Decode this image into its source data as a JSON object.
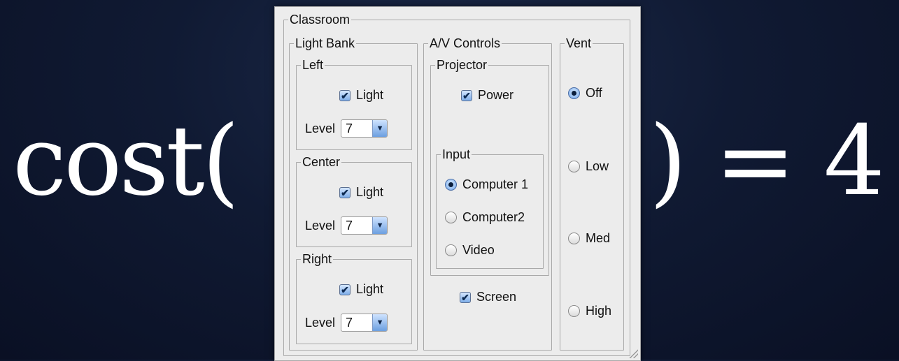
{
  "slide": {
    "cost_text": "cost(",
    "rhs_text": ") = 4"
  },
  "panel": {
    "title": "Classroom",
    "light_bank": {
      "title": "Light Bank",
      "groups": [
        {
          "title": "Left",
          "light_label": "Light",
          "light_checked": true,
          "level_label": "Level",
          "level_value": "7"
        },
        {
          "title": "Center",
          "light_label": "Light",
          "light_checked": true,
          "level_label": "Level",
          "level_value": "7"
        },
        {
          "title": "Right",
          "light_label": "Light",
          "light_checked": true,
          "level_label": "Level",
          "level_value": "7"
        }
      ]
    },
    "av": {
      "title": "A/V Controls",
      "projector": {
        "title": "Projector",
        "power_label": "Power",
        "power_checked": true,
        "input": {
          "title": "Input",
          "options": [
            "Computer 1",
            "Computer2",
            "Video"
          ],
          "selected": "Computer 1"
        }
      },
      "screen_label": "Screen",
      "screen_checked": true
    },
    "vent": {
      "title": "Vent",
      "options": [
        "Off",
        "Low",
        "Med",
        "High"
      ],
      "selected": "Off"
    }
  },
  "colors": {
    "background": "#101a33",
    "panel": "#ececec",
    "accent": "#7eaee9"
  }
}
